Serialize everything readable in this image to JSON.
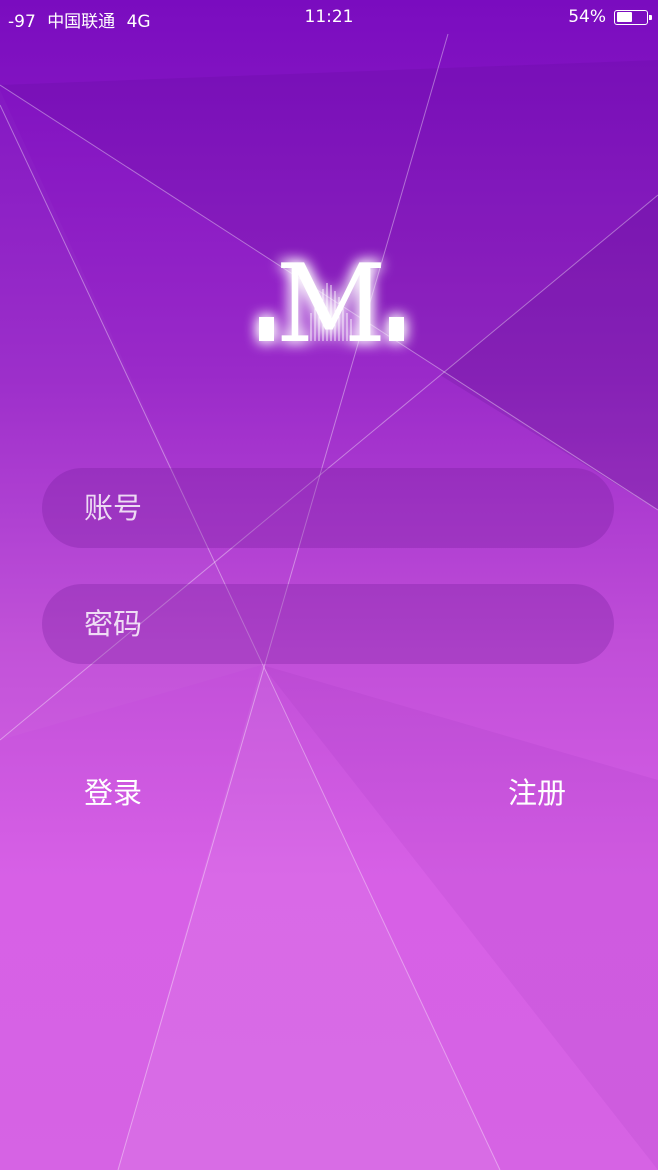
{
  "status_bar": {
    "signal": "-97",
    "carrier": "中国联通",
    "network": "4G",
    "time": "11:21",
    "battery_percent": "54%",
    "battery_level": 0.54
  },
  "logo": {
    "letter": "M",
    "icon": "m-logo-icon"
  },
  "login_form": {
    "account_placeholder": "账号",
    "password_placeholder": "密码",
    "login_label": "登录",
    "register_label": "注册"
  },
  "colors": {
    "gradient_top": "#7a0cbf",
    "gradient_bottom": "#d663e4",
    "text": "#ffffff"
  }
}
